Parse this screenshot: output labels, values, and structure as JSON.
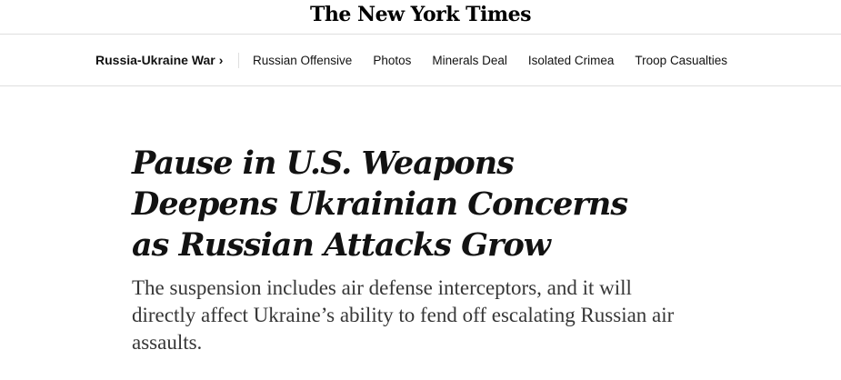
{
  "masthead": {
    "logo_text": "The New York Times"
  },
  "subnav": {
    "section_label": "Russia-Ukraine War",
    "chevron": "›",
    "links": [
      "Russian Offensive",
      "Photos",
      "Minerals Deal",
      "Isolated Crimea",
      "Troop Casualties"
    ]
  },
  "article": {
    "headline": "Pause in U.S. Weapons Deepens Ukrainian Concerns as Russian Attacks Grow",
    "summary": "The suspension includes air defense interceptors, and it will directly affect Ukraine’s ability to fend off escalating Russian air assaults."
  }
}
